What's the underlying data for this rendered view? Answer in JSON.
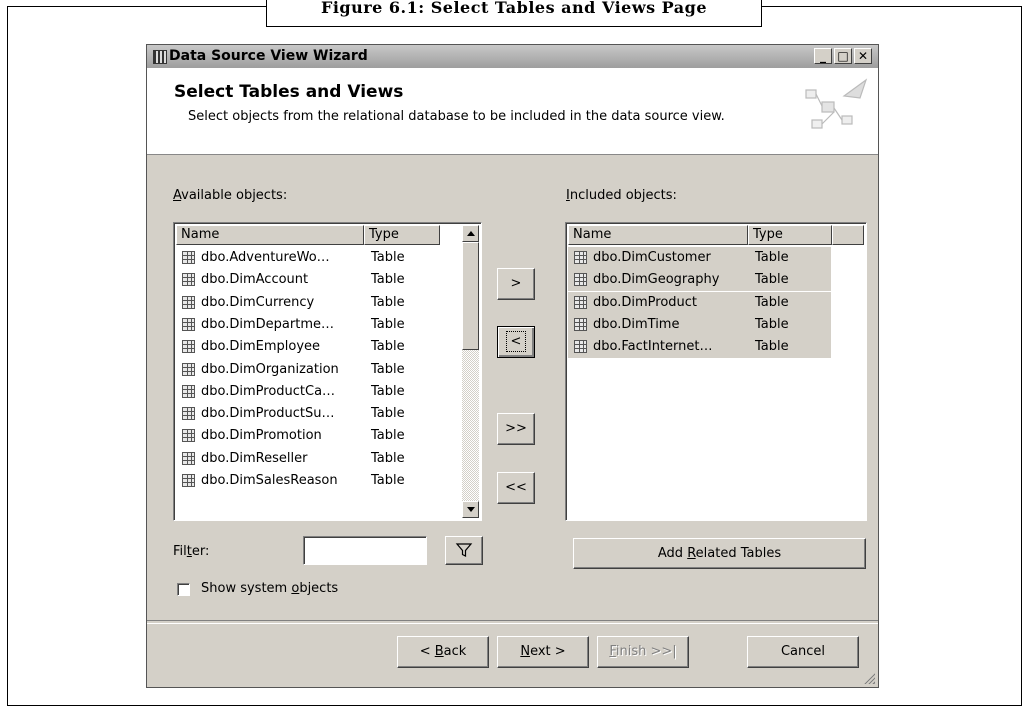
{
  "figure_caption": "Figure 6.1: Select Tables and Views Page",
  "window": {
    "title": "Data Source View Wizard",
    "controls": {
      "minimize": "_",
      "maximize": "□",
      "close": "✕"
    }
  },
  "header": {
    "title": "Select Tables and Views",
    "description": "Select objects from the relational database to be included in the data source view."
  },
  "available": {
    "label_prefix": "",
    "label_mnemonic": "A",
    "label_rest": "vailable objects:",
    "columns": {
      "name": "Name",
      "type": "Type"
    },
    "rows": [
      {
        "name": "dbo.AdventureWo…",
        "type": "Table"
      },
      {
        "name": "dbo.DimAccount",
        "type": "Table"
      },
      {
        "name": "dbo.DimCurrency",
        "type": "Table"
      },
      {
        "name": "dbo.DimDepartme…",
        "type": "Table"
      },
      {
        "name": "dbo.DimEmployee",
        "type": "Table"
      },
      {
        "name": "dbo.DimOrganization",
        "type": "Table"
      },
      {
        "name": "dbo.DimProductCa…",
        "type": "Table"
      },
      {
        "name": "dbo.DimProductSu…",
        "type": "Table"
      },
      {
        "name": "dbo.DimPromotion",
        "type": "Table"
      },
      {
        "name": "dbo.DimReseller",
        "type": "Table"
      },
      {
        "name": "dbo.DimSalesReason",
        "type": "Table"
      }
    ]
  },
  "included": {
    "label_mnemonic": "I",
    "label_rest": "ncluded objects:",
    "columns": {
      "name": "Name",
      "type": "Type"
    },
    "rows": [
      {
        "name": "dbo.DimCustomer",
        "type": "Table"
      },
      {
        "name": "dbo.DimGeography",
        "type": "Table"
      },
      {
        "name": "dbo.DimProduct",
        "type": "Table"
      },
      {
        "name": "dbo.DimTime",
        "type": "Table"
      },
      {
        "name": "dbo.FactInternet…",
        "type": "Table"
      }
    ]
  },
  "move_buttons": {
    "add": ">",
    "remove": "<",
    "add_all": ">>",
    "remove_all": "<<"
  },
  "filter": {
    "label_pre": "Fil",
    "label_mnemonic": "t",
    "label_post": "er:",
    "value": "",
    "icon": "filter-funnel-icon"
  },
  "show_system": {
    "label_pre": "Show system ",
    "label_mnemonic": "o",
    "label_post": "bjects",
    "checked": false
  },
  "add_related": {
    "label_pre": "Add ",
    "label_mnemonic": "R",
    "label_post": "elated Tables"
  },
  "footer": {
    "back": {
      "pre": "< ",
      "mn": "B",
      "post": "ack"
    },
    "next": {
      "pre": "",
      "mn": "N",
      "post": "ext >"
    },
    "finish": {
      "pre": "",
      "mn": "F",
      "post": "inish >>|"
    },
    "cancel": "Cancel"
  }
}
